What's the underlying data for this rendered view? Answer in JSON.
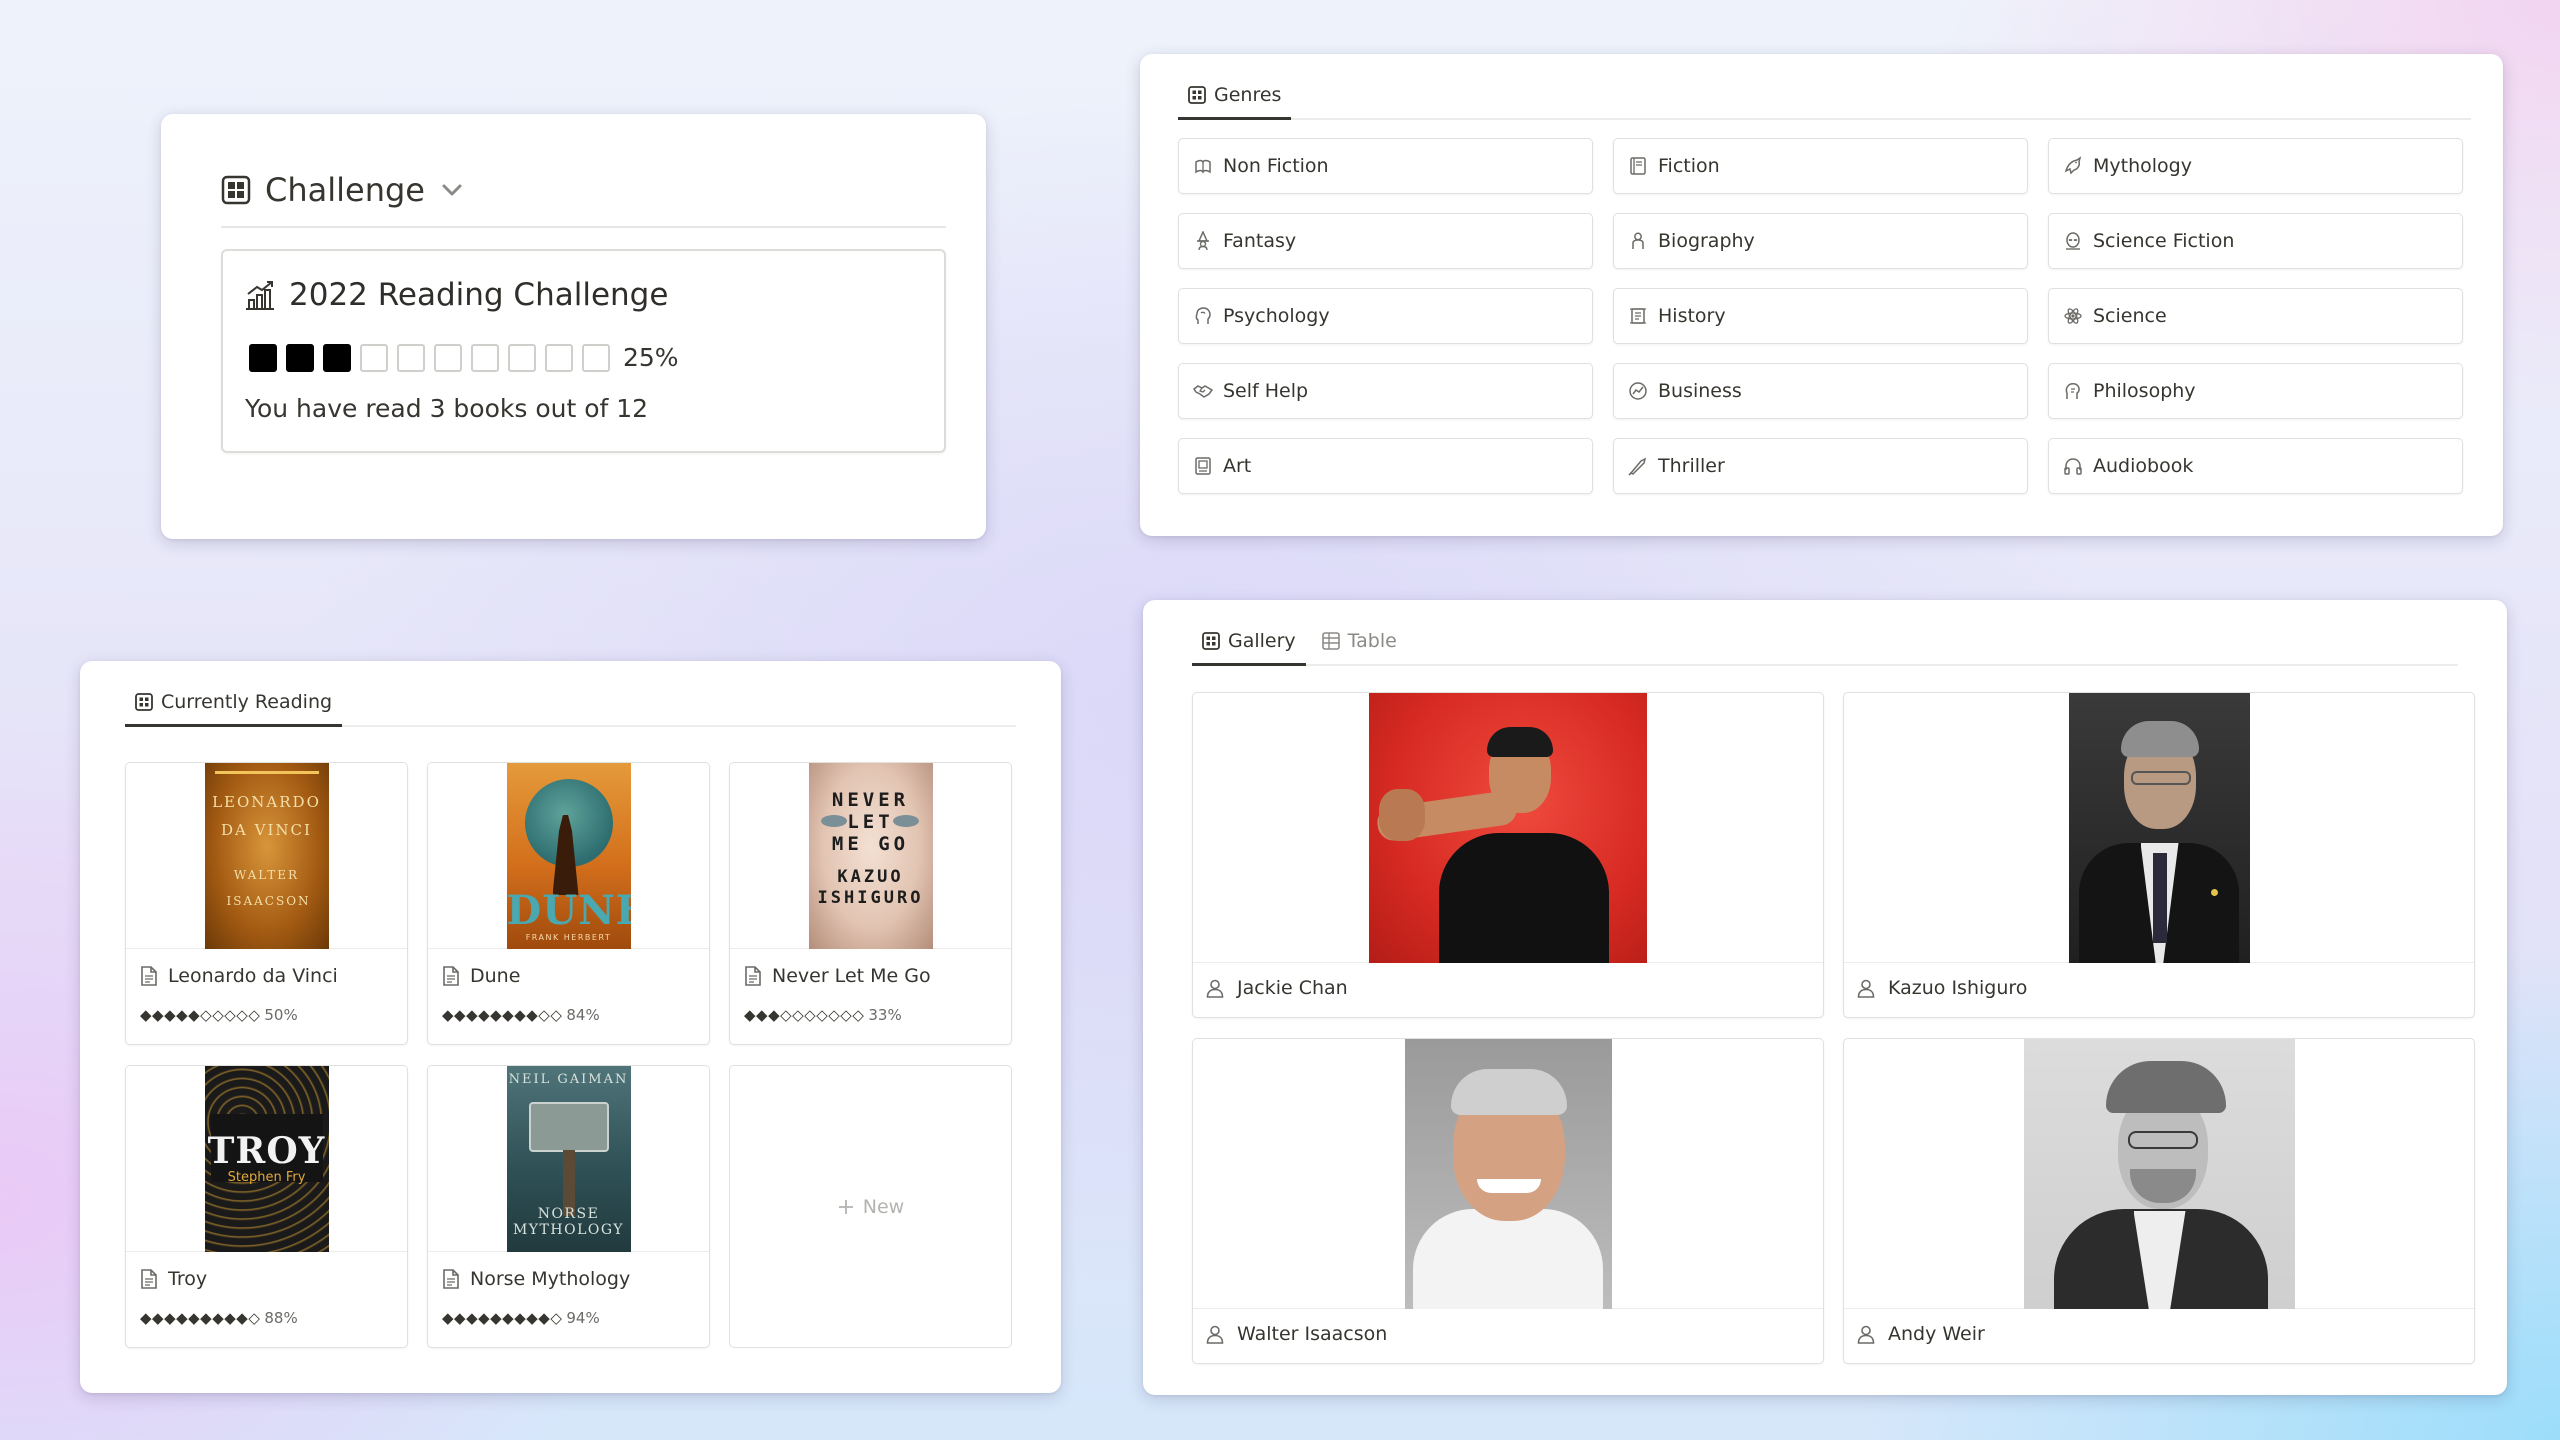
{
  "challenge": {
    "view_title": "Challenge",
    "card_title": "2022 Reading Challenge",
    "progress_filled": 3,
    "progress_total": 10,
    "percent": "25%",
    "summary": "You have read 3 books out of 12"
  },
  "genres": {
    "tab_label": "Genres",
    "items": [
      {
        "label": "Non Fiction",
        "icon": "reading-icon"
      },
      {
        "label": "Fiction",
        "icon": "book-icon"
      },
      {
        "label": "Mythology",
        "icon": "dragon-icon"
      },
      {
        "label": "Fantasy",
        "icon": "wizard-icon"
      },
      {
        "label": "Biography",
        "icon": "person-icon"
      },
      {
        "label": "Science Fiction",
        "icon": "alien-icon"
      },
      {
        "label": "Psychology",
        "icon": "head-icon"
      },
      {
        "label": "History",
        "icon": "scroll-icon"
      },
      {
        "label": "Science",
        "icon": "atom-icon"
      },
      {
        "label": "Self Help",
        "icon": "handshake-icon"
      },
      {
        "label": "Business",
        "icon": "chart-icon"
      },
      {
        "label": "Philosophy",
        "icon": "thinker-icon"
      },
      {
        "label": "Art",
        "icon": "palette-icon"
      },
      {
        "label": "Thriller",
        "icon": "knife-icon"
      },
      {
        "label": "Audiobook",
        "icon": "headphones-icon"
      }
    ]
  },
  "reading": {
    "tab_label": "Currently Reading",
    "new_label": "New",
    "books": [
      {
        "title": "Leonardo da Vinci",
        "rating": "◆◆◆◆◆◇◇◇◇◇",
        "percent": "50%",
        "cover": {
          "lines": [
            "LEONARDO",
            "DA VINCI"
          ],
          "author": "WALTER ISAACSON",
          "bg": "#b36a12"
        }
      },
      {
        "title": "Dune",
        "rating": "◆◆◆◆◆◆◆◆◇◇",
        "percent": "84%",
        "cover": {
          "lines": [
            "DUNE"
          ],
          "author": "FRANK HERBERT",
          "bg": "#c46a1c"
        }
      },
      {
        "title": "Never Let Me Go",
        "rating": "◆◆◆◇◇◇◇◇◇◇",
        "percent": "33%",
        "cover": {
          "lines": [
            "NEVER",
            "LET",
            "ME GO"
          ],
          "author": "KAZUO ISHIGURO",
          "bg": "#e9d4c6"
        }
      },
      {
        "title": "Troy",
        "rating": "◆◆◆◆◆◆◆◆◆◇",
        "percent": "88%",
        "cover": {
          "lines": [
            "TROY"
          ],
          "author": "Stephen Fry",
          "bg": "#141414"
        }
      },
      {
        "title": "Norse Mythology",
        "rating": "◆◆◆◆◆◆◆◆◆◇",
        "percent": "94%",
        "cover": {
          "lines": [
            "NORSE",
            "MYTHOLOGY"
          ],
          "author": "NEIL GAIMAN",
          "bg": "#3b5a5e"
        }
      }
    ]
  },
  "people": {
    "tabs": [
      {
        "label": "Gallery",
        "active": true
      },
      {
        "label": "Table",
        "active": false
      }
    ],
    "items": [
      {
        "name": "Jackie Chan"
      },
      {
        "name": "Kazuo Ishiguro"
      },
      {
        "name": "Walter Isaacson"
      },
      {
        "name": "Andy Weir"
      }
    ]
  }
}
